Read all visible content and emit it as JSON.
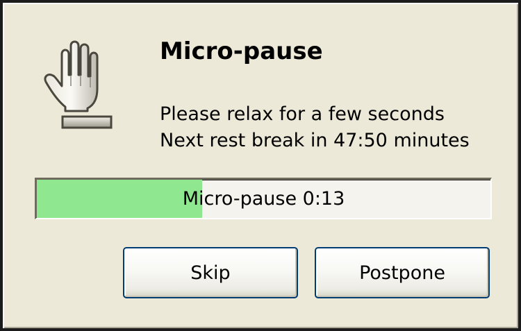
{
  "dialog": {
    "title": "Micro-pause",
    "message_lines": [
      "Please relax for a few seconds",
      "Next rest break in 47:50 minutes"
    ],
    "icon": "raised-hand-icon"
  },
  "progress": {
    "label": "Micro-pause 0:13",
    "fraction": 0.365,
    "fill_color": "#8fe88f"
  },
  "buttons": {
    "skip_label": "Skip",
    "postpone_label": "Postpone"
  }
}
